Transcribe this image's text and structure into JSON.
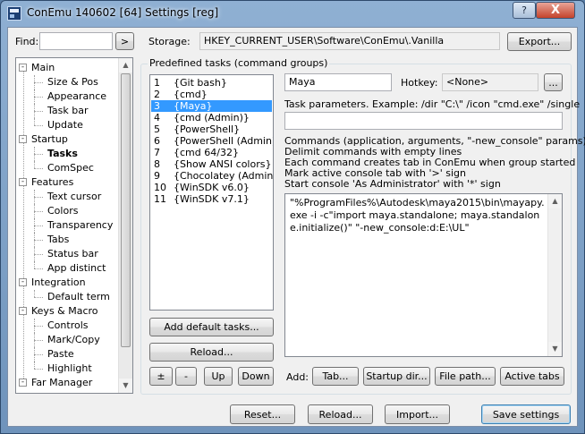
{
  "window": {
    "title": "ConEmu 140602 [64] Settings [reg]",
    "help_label": "?",
    "close_label": "X"
  },
  "find": {
    "label": "Find:",
    "value": "",
    "go_label": ">"
  },
  "storage": {
    "label": "Storage:",
    "value": "HKEY_CURRENT_USER\\Software\\ConEmu\\.Vanilla",
    "export_label": "Export..."
  },
  "tree": {
    "nodes": [
      {
        "label": "Main",
        "toggle": "-"
      },
      {
        "label": "Size & Pos"
      },
      {
        "label": "Appearance"
      },
      {
        "label": "Task bar"
      },
      {
        "label": "Update"
      },
      {
        "label": "Startup",
        "toggle": "-"
      },
      {
        "label": "Tasks"
      },
      {
        "label": "ComSpec"
      },
      {
        "label": "Features",
        "toggle": "-"
      },
      {
        "label": "Text cursor"
      },
      {
        "label": "Colors"
      },
      {
        "label": "Transparency"
      },
      {
        "label": "Tabs"
      },
      {
        "label": "Status bar"
      },
      {
        "label": "App distinct"
      },
      {
        "label": "Integration",
        "toggle": "-"
      },
      {
        "label": "Default term"
      },
      {
        "label": "Keys & Macro",
        "toggle": "-"
      },
      {
        "label": "Controls"
      },
      {
        "label": "Mark/Copy"
      },
      {
        "label": "Paste"
      },
      {
        "label": "Highlight"
      },
      {
        "label": "Far Manager",
        "toggle": "-"
      }
    ],
    "selected": "Tasks"
  },
  "tasks_group": {
    "title": "Predefined tasks (command groups)",
    "tasks": [
      {
        "num": "1",
        "name": "{Git bash}"
      },
      {
        "num": "2",
        "name": "{cmd}"
      },
      {
        "num": "3",
        "name": "{Maya}"
      },
      {
        "num": "4",
        "name": "{cmd (Admin)}"
      },
      {
        "num": "5",
        "name": "{PowerShell}"
      },
      {
        "num": "6",
        "name": "{PowerShell (Admin)}"
      },
      {
        "num": "7",
        "name": "{cmd 64/32}"
      },
      {
        "num": "8",
        "name": "{Show ANSI colors}"
      },
      {
        "num": "9",
        "name": "{Chocolatey (Admin)}"
      },
      {
        "num": "10",
        "name": "{WinSDK v6.0}"
      },
      {
        "num": "11",
        "name": "{WinSDK v7.1}"
      }
    ],
    "selected_index": 2,
    "add_default_label": "Add default tasks...",
    "reload_label": "Reload...",
    "plus_label": "±",
    "minus_label": "-",
    "up_label": "Up",
    "down_label": "Down"
  },
  "task_editor": {
    "name_value": "Maya",
    "hotkey_label": "Hotkey:",
    "hotkey_value": "<None>",
    "hotkey_btn": "...",
    "params_label": "Task parameters. Example: /dir \"C:\\\" /icon \"cmd.exe\" /single",
    "params_value": "",
    "help_lines": [
      "Commands (application, arguments, \"-new_console\" params)",
      "Delimit commands with empty lines",
      "Each command creates tab in ConEmu when group started",
      "Mark active console tab with '>' sign",
      "Start console 'As Administrator' with '*' sign"
    ],
    "commands": "\"%ProgramFiles%\\Autodesk\\maya2015\\bin\\mayapy.exe -i -c\"import maya.standalone; maya.standalone.initialize()\" \"-new_console:d:E:\\UL\"",
    "add_label": "Add:",
    "tab_btn": "Tab...",
    "startup_btn": "Startup dir...",
    "filepath_btn": "File path...",
    "active_btn": "Active tabs"
  },
  "footer": {
    "reset_label": "Reset...",
    "reload_label": "Reload...",
    "import_label": "Import...",
    "save_label": "Save settings"
  }
}
